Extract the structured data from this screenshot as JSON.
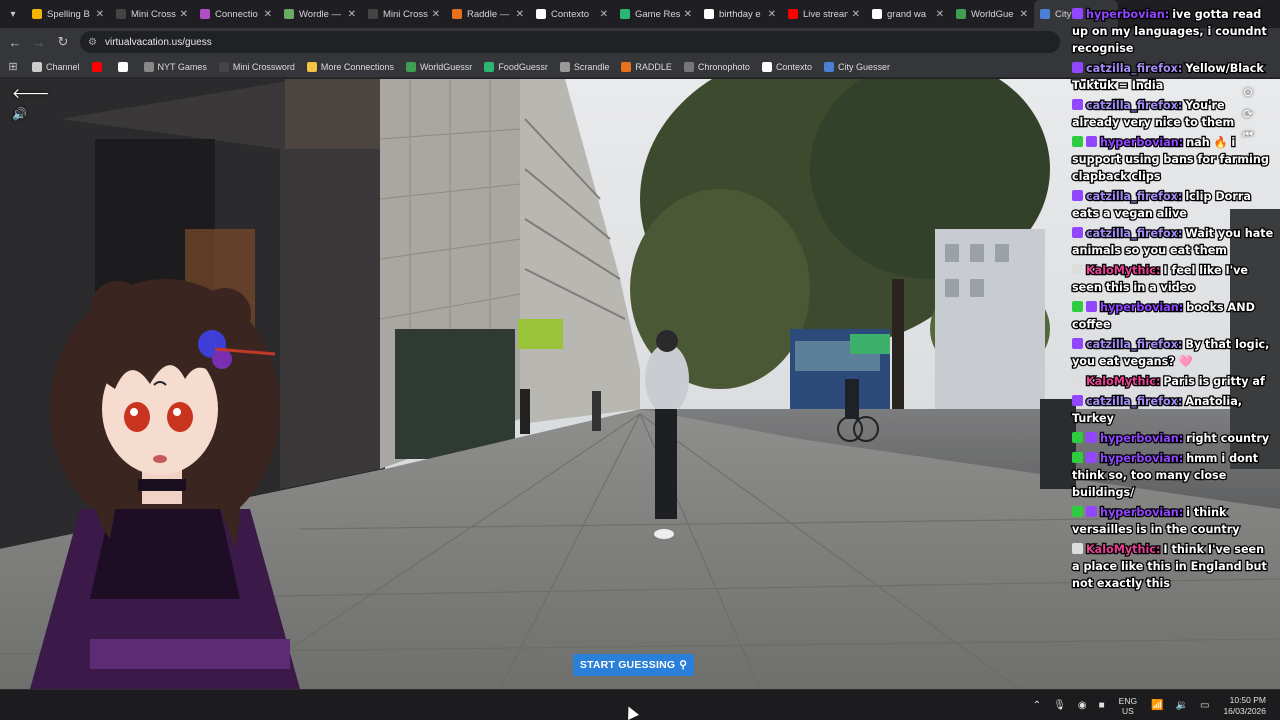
{
  "tabs": [
    {
      "label": "Spelling B",
      "color": "#f4b400",
      "active": false
    },
    {
      "label": "Mini Cross",
      "color": "#444444",
      "active": false
    },
    {
      "label": "Connectio",
      "color": "#b04ec9",
      "active": false
    },
    {
      "label": "Wordle —",
      "color": "#6aaa64",
      "active": false
    },
    {
      "label": "Mini Cross",
      "color": "#444444",
      "active": false
    },
    {
      "label": "Raddle —",
      "color": "#e8711c",
      "active": false
    },
    {
      "label": "Contexto",
      "color": "#ffffff",
      "active": false
    },
    {
      "label": "Game Res",
      "color": "#2bb673",
      "active": false
    },
    {
      "label": "birthday e",
      "color": "#ffffff",
      "active": false
    },
    {
      "label": "Live strean",
      "color": "#ff0000",
      "active": false
    },
    {
      "label": "grand wa",
      "color": "#ffffff",
      "active": false
    },
    {
      "label": "WorldGue",
      "color": "#3f9e4f",
      "active": false
    },
    {
      "label": "City G",
      "color": "#4a7fd6",
      "active": true
    }
  ],
  "address": {
    "url": "virtualvacation.us/guess"
  },
  "bookmarks": [
    {
      "label": "Channel",
      "icon": "folder-icon",
      "color": "#cccccc"
    },
    {
      "label": "",
      "icon": "youtube-icon",
      "color": "#ff0000"
    },
    {
      "label": "",
      "icon": "x-icon",
      "color": "#ffffff"
    },
    {
      "label": "NYT Games",
      "icon": "nyt-icon",
      "color": "#888888"
    },
    {
      "label": "Mini Crossword",
      "icon": "crossword-icon",
      "color": "#444444"
    },
    {
      "label": "More Connections",
      "icon": "grid-icon",
      "color": "#f4c542"
    },
    {
      "label": "WorldGuessr",
      "icon": "globe-icon",
      "color": "#3f9e4f"
    },
    {
      "label": "FoodGuessr",
      "icon": "food-icon",
      "color": "#2bb673"
    },
    {
      "label": "Scrandle",
      "icon": "scrandle-icon",
      "color": "#999999"
    },
    {
      "label": "RADDLE",
      "icon": "raddle-icon",
      "color": "#e8711c"
    },
    {
      "label": "Chronophoto",
      "icon": "camera-icon",
      "color": "#777777"
    },
    {
      "label": "Contexto",
      "icon": "contexto-icon",
      "color": "#ffffff"
    },
    {
      "label": "City Guesser",
      "icon": "globe-icon",
      "color": "#4a7fd6"
    }
  ],
  "game": {
    "start_label": "START GUESSING"
  },
  "chat": [
    {
      "user": "hyperbovian:",
      "text": "ive gotta read up on my languages, i coundnt recognise",
      "color": "purple",
      "badges": [
        "#9146ff"
      ]
    },
    {
      "user": "catzilla_firefox:",
      "text": "Yellow/Black Tuktuk = India",
      "color": "lav",
      "badges": [
        "#9146ff"
      ]
    },
    {
      "user": "catzilla_firefox:",
      "text": "You're already very nice to them",
      "color": "lav",
      "badges": [
        "#9146ff"
      ]
    },
    {
      "user": "hyperbovian:",
      "text": "nah 🔥 i support using bans for farming clapback clips",
      "color": "purple",
      "badges": [
        "#2ecc40",
        "#9146ff"
      ]
    },
    {
      "user": "catzilla_firefox:",
      "text": "lclip Dorra eats a vegan alive",
      "color": "lav",
      "badges": [
        "#9146ff"
      ]
    },
    {
      "user": "catzilla_firefox:",
      "text": "Wait you hate animals so you eat them",
      "color": "lav",
      "badges": [
        "#9146ff"
      ]
    },
    {
      "user": "KaloMythic:",
      "text": "I feel like I've seen this in a video",
      "color": "pink",
      "badges": [
        "#dddddd"
      ]
    },
    {
      "user": "hyperbovian:",
      "text": "books AND coffee",
      "color": "purple",
      "badges": [
        "#2ecc40",
        "#9146ff"
      ]
    },
    {
      "user": "catzilla_firefox:",
      "text": "By that logic, you eat vegans? 🩷",
      "color": "lav",
      "badges": [
        "#9146ff"
      ]
    },
    {
      "user": "KaloMythic:",
      "text": "Paris is gritty af",
      "color": "pink",
      "badges": [
        "#dddddd"
      ]
    },
    {
      "user": "catzilla_firefox:",
      "text": "Anatolia, Turkey",
      "color": "lav",
      "badges": [
        "#9146ff"
      ]
    },
    {
      "user": "hyperbovian:",
      "text": "right country",
      "color": "purple",
      "badges": [
        "#2ecc40",
        "#9146ff"
      ]
    },
    {
      "user": "hyperbovian:",
      "text": "hmm i dont think so, too many close buildings/",
      "color": "purple",
      "badges": [
        "#2ecc40",
        "#9146ff"
      ]
    },
    {
      "user": "hyperbovian:",
      "text": "i think versailles is in the country",
      "color": "purple",
      "badges": [
        "#2ecc40",
        "#9146ff"
      ]
    },
    {
      "user": "KaloMythic:",
      "text": "I think I've seen a place like this in England but not exactly this",
      "color": "pink",
      "badges": [
        "#dddddd"
      ]
    }
  ],
  "taskbar": {
    "lang_top": "ENG",
    "lang_bottom": "US",
    "time": "10:50 PM",
    "date": "16/03/2026"
  },
  "colors": {
    "start_button": "#2a7fd9",
    "chrome_dark": "#202124",
    "chrome_bar": "#35363a"
  }
}
